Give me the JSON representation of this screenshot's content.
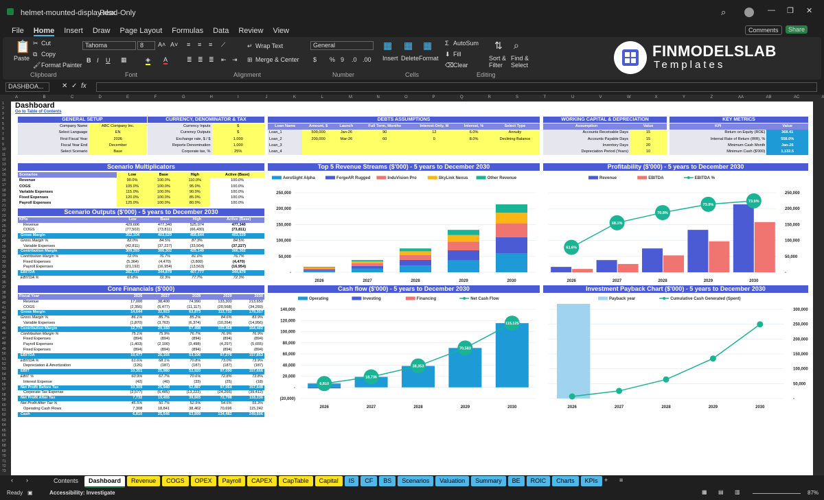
{
  "window": {
    "title": "helmet-mounted-display.xlsx",
    "mode": "Read-Only"
  },
  "menu": [
    "File",
    "Home",
    "Insert",
    "Draw",
    "Page Layout",
    "Formulas",
    "Data",
    "Review",
    "View"
  ],
  "menu_right": {
    "comments": "Comments",
    "share": "Share"
  },
  "ribbon": {
    "paste": "Paste",
    "cut": "Cut",
    "copy": "Copy",
    "format_painter": "Format Painter",
    "clipboard": "Clipboard",
    "font_name": "Tahoma",
    "font_size": "8",
    "font": "Font",
    "wrap": "Wrap Text",
    "merge": "Merge & Center",
    "alignment": "Alignment",
    "numfmt": "General",
    "number": "Number",
    "insert": "Insert",
    "delete": "Delete",
    "format": "Format",
    "cells": "Cells",
    "autosum": "AutoSum",
    "fill": "Fill",
    "clear": "Clear",
    "sort": "Sort & Filter",
    "find": "Find & Select",
    "editing": "Editing"
  },
  "brand": {
    "name": "FINMODELSLAB",
    "sub": "Templates"
  },
  "formula": {
    "namebox": "DASHBOA...",
    "fx": "fx"
  },
  "columns": [
    "A",
    "B",
    "C",
    "D",
    "E",
    "F",
    "G",
    "H",
    "I",
    "J",
    "K",
    "L",
    "M",
    "N",
    "O",
    "P",
    "Q",
    "R",
    "S",
    "T",
    "U",
    "V",
    "W",
    "X",
    "Y",
    "Z",
    "AA",
    "AB",
    "AC",
    "AD"
  ],
  "sheet": {
    "title": "Dashboard",
    "toc": "Go to Table of Contents",
    "general": {
      "title": "GENERAL SETUP",
      "rows": [
        [
          "Company Name",
          "ABC Company Inc."
        ],
        [
          "Select Language",
          "EN"
        ],
        [
          "First Fiscal Year",
          "2026"
        ],
        [
          "Fiscal Year End",
          "December"
        ],
        [
          "Select Scenario",
          "Base"
        ]
      ]
    },
    "currency": {
      "title": "CURRENCY, DENOMINATOR & TAX",
      "rows": [
        [
          "Currency Inputs",
          "$"
        ],
        [
          "Currency Outputs",
          "$"
        ],
        [
          "Exchange rate, $ / $",
          "1.000"
        ],
        [
          "Reports Denomination",
          "1,000"
        ],
        [
          "Corporate tax, %",
          "25%"
        ]
      ]
    },
    "debts": {
      "title": "DEBTS ASSUMPTIONS",
      "head": [
        "Loan Name",
        "Amount, $",
        "Launch",
        "Full Term, Months",
        "Interest-Only, M",
        "Interest, %",
        "Select Type"
      ],
      "rows": [
        [
          "Loan_1",
          "500,000",
          "Jan-26",
          "90",
          "12",
          "6.0%",
          "Annuity"
        ],
        [
          "Loan_2",
          "200,000",
          "Mar-26",
          "60",
          "0",
          "8.0%",
          "Declining Balance"
        ],
        [
          "Loan_3",
          "",
          "",
          "",
          "",
          "",
          ""
        ],
        [
          "Loan_4",
          "",
          "",
          "",
          "",
          "",
          ""
        ]
      ]
    },
    "wc": {
      "title": "WORKING CAPITAL & DEPRECIATION",
      "head": [
        "Assumption",
        "Value"
      ],
      "rows": [
        [
          "Accounts Receivable Days",
          "15"
        ],
        [
          "Accounts Payable Days",
          "15"
        ],
        [
          "Inventory Days",
          "20"
        ],
        [
          "Depreciation Period (Years)",
          "10"
        ]
      ]
    },
    "kpi": {
      "title": "KEY METRICS",
      "head": [
        "KPI",
        "Value"
      ],
      "rows": [
        [
          "Return on Equity (ROE)",
          "368.41"
        ],
        [
          "Internal Rate of Return (IRR), %",
          "558.0%"
        ],
        [
          "Minimum Cash Month",
          "Jan-26"
        ],
        [
          "Minimum Cash ($'000)",
          "1,132.5"
        ]
      ]
    },
    "mult": {
      "title": "Scenario Multiplicators",
      "head": [
        "Scenarios",
        "Low",
        "Base",
        "High",
        "Active (Base)"
      ],
      "rows": [
        [
          "Revenue",
          "90.0%",
          "100.0%",
          "110.0%",
          "100.0%"
        ],
        [
          "COGS",
          "105.0%",
          "100.0%",
          "95.0%",
          "100.0%"
        ],
        [
          "Variable Expenses",
          "115.0%",
          "100.0%",
          "90.0%",
          "100.0%"
        ],
        [
          "Fixed Expenses",
          "120.0%",
          "100.0%",
          "85.0%",
          "100.0%"
        ],
        [
          "Payroll Expenses",
          "125.0%",
          "100.0%",
          "80.0%",
          "100.0%"
        ]
      ]
    },
    "outputs": {
      "title": "Scenario Outputs ($'000) - 5 years to December 2030",
      "head": [
        "KPIs",
        "Low",
        "Base",
        "High",
        "Active (Base)"
      ],
      "rows": [
        [
          "Revenue",
          "429,606",
          "477,340",
          "525,074",
          "477,340",
          ""
        ],
        [
          "COGS",
          "(77,502)",
          "(73,811)",
          "(66,430)",
          "(73,811)",
          ""
        ],
        [
          "Gross Margin",
          "352,104",
          "403,529",
          "458,644",
          "403,529",
          "hl"
        ],
        [
          "Gross Margin %",
          "82.0%",
          "84.5%",
          "87.3%",
          "84.5%",
          "it"
        ],
        [
          "Variable Expenses",
          "(42,811)",
          "(37,227)",
          "(33,504)",
          "(37,227)",
          ""
        ],
        [
          "Contribution Margin",
          "309,293",
          "366,302",
          "425,140",
          "366,302",
          "hl"
        ],
        [
          "Contribution Margin %",
          "72.0%",
          "76.7%",
          "81.0%",
          "76.7%",
          "it"
        ],
        [
          "Fixed Expenses",
          "(5,364)",
          "(4,470)",
          "(3,800)",
          "(4,470)",
          ""
        ],
        [
          "Payroll Expenses",
          "(21,192)",
          "(16,954)",
          "(13,563)",
          "(16,954)",
          ""
        ],
        [
          "EBITDA",
          "282,737",
          "344,878",
          "407,777",
          "344,878",
          "hl"
        ],
        [
          "EBITDA %",
          "65.8%",
          "72.3%",
          "77.7%",
          "72.3%",
          "it"
        ]
      ]
    },
    "core": {
      "title": "Core Financials ($'000)",
      "head": [
        "Fiscal Year",
        "2026",
        "2027",
        "2028",
        "2029",
        "2030"
      ],
      "rows": [
        [
          "Revenue",
          "17,000",
          "38,400",
          "74,990",
          "133,300",
          "213,650",
          ""
        ],
        [
          "COGS",
          "(2,356)",
          "(5,477)",
          "(11,117)",
          "(20,568)",
          "(34,293)",
          ""
        ],
        [
          "Gross Margin",
          "14,644",
          "32,923",
          "63,873",
          "112,732",
          "179,357",
          "hl"
        ],
        [
          "Gross Margin %",
          "86.1%",
          "85.7%",
          "85.2%",
          "84.6%",
          "83.9%",
          "it"
        ],
        [
          "Variable Expenses",
          "(1,870)",
          "(3,763)",
          "(6,374)",
          "(10,264)",
          "(14,956)",
          ""
        ],
        [
          "Contribution Margin",
          "12,774",
          "29,160",
          "57,498",
          "102,468",
          "164,402",
          "hl"
        ],
        [
          "Contribution Margin %",
          "75.1%",
          "75.9%",
          "76.7%",
          "76.9%",
          "76.9%",
          "it"
        ],
        [
          "Fixed Expenses",
          "(894)",
          "(894)",
          "(894)",
          "(894)",
          "(894)",
          ""
        ],
        [
          "Payroll Expenses",
          "(1,403)",
          "(2,100)",
          "(3,498)",
          "(4,297)",
          "(5,655)",
          ""
        ],
        [
          "Fixed Expenses",
          "(894)",
          "(894)",
          "(894)",
          "(894)",
          "(894)",
          ""
        ],
        [
          "EBITDA",
          "10,477",
          "26,166",
          "53,106",
          "97,276",
          "157,853",
          "hl"
        ],
        [
          "EBITDA %",
          "61.6%",
          "68.1%",
          "70.8%",
          "73.0%",
          "73.9%",
          "it"
        ],
        [
          "Depreciation & Amortization",
          "(126)",
          "(187)",
          "(187)",
          "(187)",
          "(187)",
          ""
        ],
        [
          "EBIT",
          "10,351",
          "25,980",
          "52,920",
          "97,090",
          "157,666",
          "hl"
        ],
        [
          "EBIT %",
          "60.9%",
          "67.7%",
          "70.6%",
          "72.8%",
          "73.8%",
          "it"
        ],
        [
          "Interest Expense",
          "(42)",
          "(40)",
          "(33)",
          "(25)",
          "(18)",
          ""
        ],
        [
          "Net Profit Before Tax",
          "10,309",
          "25,940",
          "52,887",
          "97,064",
          "157,648",
          "hl"
        ],
        [
          "Corporate Tax Expense",
          "(2,577)",
          "(6,485)",
          "(13,222)",
          "(24,266)",
          "(39,412)",
          ""
        ],
        [
          "Net Profit After Tax",
          "7,732",
          "19,455",
          "39,665",
          "72,798",
          "118,236",
          "hl"
        ],
        [
          "Net Profit After Tax %",
          "45.5%",
          "50.7%",
          "52.9%",
          "54.6%",
          "55.3%",
          "it"
        ],
        [
          "Operating Cash Flows",
          "7,308",
          "18,841",
          "38,462",
          "70,696",
          "115,242",
          ""
        ],
        [
          "Cash",
          "6,810",
          "25,546",
          "63,899",
          "134,482",
          "249,606",
          "hl"
        ]
      ]
    }
  },
  "charts": {
    "rev": {
      "title": "Top 5 Revenue Streams ($'000) - 5 years to December 2030",
      "type": "bar",
      "categories": [
        "2026",
        "2027",
        "2028",
        "2029",
        "2030"
      ],
      "series": [
        {
          "name": "AeroSight Alpha",
          "color": "#1e9bd7",
          "values": [
            5000,
            11000,
            21000,
            37000,
            59000
          ]
        },
        {
          "name": "ForgeAR Rugged",
          "color": "#4a5bd4",
          "values": [
            4000,
            9000,
            18000,
            32000,
            51000
          ]
        },
        {
          "name": "InduVision Pro",
          "color": "#f07470",
          "values": [
            3500,
            8000,
            15000,
            27000,
            43000
          ]
        },
        {
          "name": "SkyLink Nexus",
          "color": "#fbb615",
          "values": [
            2500,
            6000,
            12000,
            21000,
            34000
          ]
        },
        {
          "name": "Other Revenue",
          "color": "#1ab394",
          "values": [
            2000,
            4400,
            9000,
            16300,
            26650
          ]
        }
      ],
      "ylim": [
        0,
        250000
      ],
      "yticks": [
        "-",
        "50,000",
        "100,000",
        "150,000",
        "200,000",
        "250,000"
      ]
    },
    "prof": {
      "title": "Profitability ($'000) - 5 years to December 2030",
      "type": "bar+line",
      "categories": [
        "2026",
        "2027",
        "2028",
        "2029",
        "2030"
      ],
      "series": [
        {
          "name": "Revenue",
          "color": "#4a5bd4",
          "values": [
            17000,
            38400,
            74990,
            133300,
            213650
          ]
        },
        {
          "name": "EBITDA",
          "color": "#f07470",
          "values": [
            10477,
            26166,
            53106,
            97276,
            157853
          ]
        },
        {
          "name": "EBITDA %",
          "color": "#1ab394",
          "values": [
            61.6,
            68.1,
            70.8,
            73.0,
            73.9
          ]
        }
      ],
      "labels": [
        "61.6%",
        "68.1%",
        "70.8%",
        "73.0%",
        "73.9%"
      ],
      "ylim": [
        0,
        250000
      ],
      "yticks": [
        "-",
        "50,000",
        "100,000",
        "150,000",
        "200,000",
        "250,000"
      ]
    },
    "cash": {
      "title": "Cash flow ($'000) - 5 years to December 2030",
      "type": "bar+line",
      "categories": [
        "2026",
        "2027",
        "2028",
        "2029",
        "2030"
      ],
      "series": [
        {
          "name": "Operating",
          "color": "#1e9bd7",
          "values": [
            7308,
            18841,
            38462,
            70696,
            115242
          ]
        },
        {
          "name": "Investing",
          "color": "#4a5bd4",
          "values": [
            -1800,
            0,
            0,
            0,
            0
          ]
        },
        {
          "name": "Financing",
          "color": "#f07470",
          "values": [
            1300,
            0,
            0,
            0,
            0
          ]
        },
        {
          "name": "Net Cash Flow",
          "color": "#1ab394",
          "values": [
            6810,
            18736,
            38353,
            70583,
            115125
          ]
        }
      ],
      "labels": [
        "6,810",
        "18,736",
        "38,353",
        "70,583",
        "115,125"
      ],
      "ylim": [
        -20000,
        140000
      ],
      "yticks": [
        "(20,000)",
        "-",
        "20,000",
        "40,000",
        "60,000",
        "80,000",
        "100,000",
        "120,000",
        "140,000"
      ]
    },
    "payback": {
      "title": "Investment Payback Chart ($'000) - 5 years to December 2030",
      "type": "bar+line",
      "categories": [
        "2026",
        "2027",
        "2028",
        "2029",
        "2030"
      ],
      "series": [
        {
          "name": "Payback year",
          "color": "#9fd3f0",
          "values": [
            1,
            0,
            0,
            0,
            0
          ]
        },
        {
          "name": "Cumulative Cash Generated (Spent)",
          "color": "#1ab394",
          "values": [
            6810,
            25546,
            63899,
            134482,
            249606
          ]
        }
      ],
      "ylim": [
        0,
        300000
      ],
      "yticks": [
        "-",
        "50,000",
        "100,000",
        "150,000",
        "200,000",
        "250,000",
        "300,000"
      ]
    }
  },
  "tabs": [
    {
      "label": "Contents",
      "color": "#1f1f1f",
      "fg": "#ddd"
    },
    {
      "label": "Dashboard",
      "color": "#ffffff",
      "fg": "#000"
    },
    {
      "label": "Revenue",
      "color": "#fbe320"
    },
    {
      "label": "COGS",
      "color": "#fbe320"
    },
    {
      "label": "OPEX",
      "color": "#fbe320"
    },
    {
      "label": "Payroll",
      "color": "#fbe320"
    },
    {
      "label": "CAPEX",
      "color": "#fbe320"
    },
    {
      "label": "CapTable",
      "color": "#fbe320"
    },
    {
      "label": "Capital",
      "color": "#fbe320"
    },
    {
      "label": "IS",
      "color": "#4fb8e8"
    },
    {
      "label": "CF",
      "color": "#4fb8e8"
    },
    {
      "label": "BS",
      "color": "#4fb8e8"
    },
    {
      "label": "Scenarios",
      "color": "#4fb8e8"
    },
    {
      "label": "Valuation",
      "color": "#4fb8e8"
    },
    {
      "label": "Summary",
      "color": "#4fb8e8"
    },
    {
      "label": "BE",
      "color": "#4fb8e8"
    },
    {
      "label": "ROIC",
      "color": "#4fb8e8"
    },
    {
      "label": "Charts",
      "color": "#4fb8e8"
    },
    {
      "label": "KPIs",
      "color": "#4fb8e8"
    }
  ],
  "status": {
    "ready": "Ready",
    "access": "Accessibility: Investigate",
    "zoom": "87%"
  }
}
